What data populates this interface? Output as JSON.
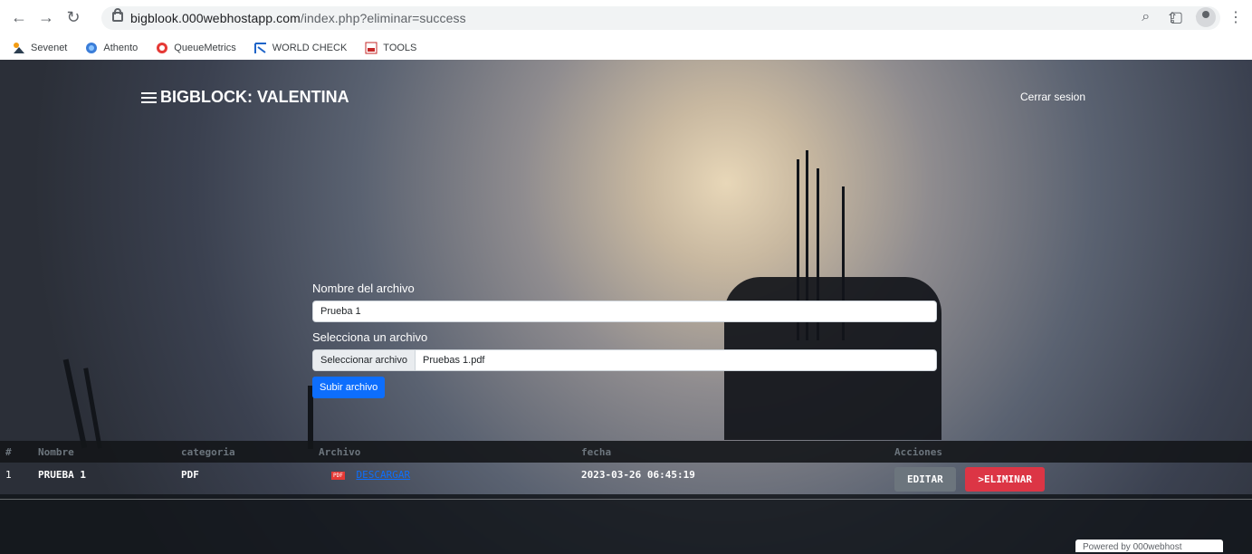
{
  "browser": {
    "url_domain": "bigblook.000webhostapp.com",
    "url_path": "/index.php?eliminar=success"
  },
  "bookmarks": [
    {
      "label": "Sevenet",
      "icon": "sevenet-icon"
    },
    {
      "label": "Athento",
      "icon": "athento-icon"
    },
    {
      "label": "QueueMetrics",
      "icon": "queuemetrics-icon"
    },
    {
      "label": "WORLD CHECK",
      "icon": "worldcheck-icon"
    },
    {
      "label": "TOOLS",
      "icon": "pdf24-icon"
    }
  ],
  "header": {
    "title": "BIGBLOCK: VALENTINA",
    "logout_label": "Cerrar sesion"
  },
  "form": {
    "name_label": "Nombre del archivo",
    "name_value": "Prueba 1",
    "file_label": "Selecciona un archivo",
    "file_button_label": "Seleccionar archivo",
    "file_name": "Pruebas 1.pdf",
    "submit_label": "Subir archivo"
  },
  "table": {
    "headers": [
      "#",
      "Nombre",
      "categoria",
      "Archivo",
      "fecha",
      "Acciones"
    ],
    "rows": [
      {
        "id": "1",
        "name": "PRUEBA 1",
        "category": "PDF",
        "file_badge": "PDF",
        "file_link": "DESCARGAR",
        "date": "2023-03-26 06:45:19",
        "edit_label": "EDITAR",
        "delete_label": ">ELIMINAR"
      }
    ]
  },
  "footer": {
    "powered_label": "Powered by 000webhost"
  },
  "colors": {
    "primary": "#0d6efd",
    "danger": "#dc3545",
    "secondary": "#6c757d"
  }
}
